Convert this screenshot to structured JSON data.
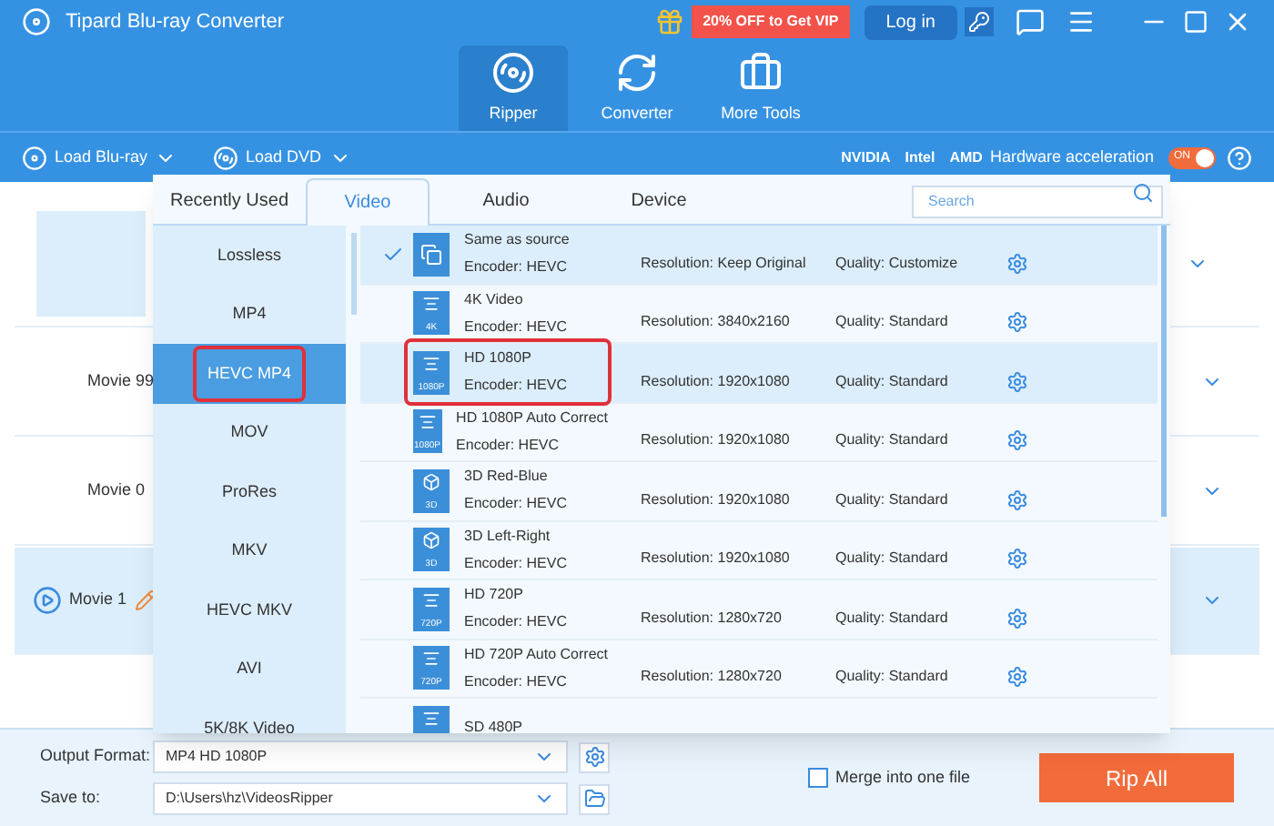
{
  "window": {
    "title": "Tipard Blu-ray Converter"
  },
  "promo": {
    "text": "20% OFF to Get VIP"
  },
  "login": {
    "label": "Log in"
  },
  "nav_tabs": [
    {
      "label": "Ripper",
      "selected": true,
      "kind": "disc"
    },
    {
      "label": "Converter",
      "selected": false,
      "kind": "convert"
    },
    {
      "label": "More Tools",
      "selected": false,
      "kind": "toolbox"
    }
  ],
  "toolbar": {
    "load_buttons": [
      {
        "label": "Load Blu-ray",
        "kind": "bluray"
      },
      {
        "label": "Load DVD",
        "kind": "dvd"
      }
    ],
    "vendors": [
      "NVIDIA",
      "Intel",
      "AMD"
    ],
    "acceleration_label": "Hardware acceleration",
    "toggle": {
      "label": "ON",
      "on": true
    }
  },
  "movies": [
    {
      "title": "Movie 99",
      "selected": false
    },
    {
      "title": "Movie 0",
      "selected": false
    },
    {
      "title": "Movie 1",
      "selected": true
    }
  ],
  "format_popup": {
    "tabs": [
      {
        "label": "Recently Used",
        "selected": false
      },
      {
        "label": "Video",
        "selected": true
      },
      {
        "label": "Audio",
        "selected": false
      },
      {
        "label": "Device",
        "selected": false
      }
    ],
    "search": {
      "placeholder": "Search"
    },
    "categories": [
      {
        "label": "Lossless",
        "selected": false,
        "circled": false
      },
      {
        "label": "MP4",
        "selected": false,
        "circled": false
      },
      {
        "label": "HEVC MP4",
        "selected": true,
        "circled": true
      },
      {
        "label": "MOV",
        "selected": false,
        "circled": false
      },
      {
        "label": "ProRes",
        "selected": false,
        "circled": false
      },
      {
        "label": "MKV",
        "selected": false,
        "circled": false
      },
      {
        "label": "HEVC MKV",
        "selected": false,
        "circled": false
      },
      {
        "label": "AVI",
        "selected": false,
        "circled": false
      },
      {
        "label": "5K/8K Video",
        "selected": false,
        "circled": false
      }
    ],
    "formats": [
      {
        "name": "Same as source",
        "encoder": "Encoder: HEVC",
        "resolution": "Resolution: Keep Original",
        "quality": "Quality: Customize",
        "kind": "copy",
        "checked": true,
        "highlighted": true,
        "circled": false
      },
      {
        "name": "4K Video",
        "encoder": "Encoder: HEVC",
        "resolution": "Resolution: 3840x2160",
        "quality": "Quality: Standard",
        "kind": "film",
        "badge": "4K",
        "checked": false,
        "highlighted": false,
        "circled": false
      },
      {
        "name": "HD 1080P",
        "encoder": "Encoder: HEVC",
        "resolution": "Resolution: 1920x1080",
        "quality": "Quality: Standard",
        "kind": "film",
        "badge": "1080P",
        "checked": false,
        "highlighted": true,
        "circled": true
      },
      {
        "name": "HD 1080P Auto Correct",
        "encoder": "Encoder: HEVC",
        "resolution": "Resolution: 1920x1080",
        "quality": "Quality: Standard",
        "kind": "film",
        "badge": "1080P",
        "checked": false,
        "highlighted": false,
        "circled": false
      },
      {
        "name": "3D Red-Blue",
        "encoder": "Encoder: HEVC",
        "resolution": "Resolution: 1920x1080",
        "quality": "Quality: Standard",
        "kind": "cube",
        "badge": "3D",
        "checked": false,
        "highlighted": false,
        "circled": false
      },
      {
        "name": "3D Left-Right",
        "encoder": "Encoder: HEVC",
        "resolution": "Resolution: 1920x1080",
        "quality": "Quality: Standard",
        "kind": "cube",
        "badge": "3D",
        "checked": false,
        "highlighted": false,
        "circled": false
      },
      {
        "name": "HD 720P",
        "encoder": "Encoder: HEVC",
        "resolution": "Resolution: 1280x720",
        "quality": "Quality: Standard",
        "kind": "film",
        "badge": "720P",
        "checked": false,
        "highlighted": false,
        "circled": false
      },
      {
        "name": "HD 720P Auto Correct",
        "encoder": "Encoder: HEVC",
        "resolution": "Resolution: 1280x720",
        "quality": "Quality: Standard",
        "kind": "film",
        "badge": "720P",
        "checked": false,
        "highlighted": false,
        "circled": false
      },
      {
        "name": "SD 480P",
        "kind": "film",
        "checked": false,
        "highlighted": false,
        "circled": false
      }
    ]
  },
  "bottom": {
    "output_format": {
      "label": "Output Format:",
      "value": "MP4 HD 1080P"
    },
    "save_to": {
      "label": "Save to:",
      "value": "D:\\Users\\hz\\VideosRipper"
    },
    "merge": {
      "label": "Merge into one file",
      "checked": false
    },
    "rip_button": "Rip All"
  }
}
